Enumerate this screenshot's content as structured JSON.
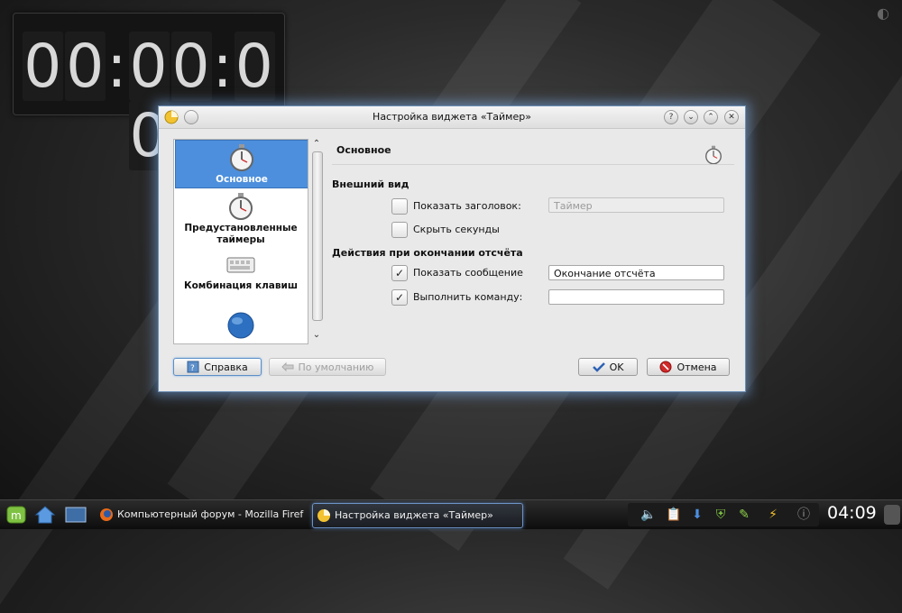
{
  "timer_widget": {
    "display": [
      "0",
      "0",
      ":",
      "0",
      "0",
      ":",
      "0",
      "0"
    ]
  },
  "dialog": {
    "title": "Настройка виджета «Таймер»",
    "sidebar": [
      {
        "label": "Основное",
        "icon": "stopwatch-icon",
        "active": true
      },
      {
        "label": "Предустановленные таймеры",
        "icon": "stopwatch-icon"
      },
      {
        "label": "Комбинация клавиш",
        "icon": "keyboard-icon"
      },
      {
        "label": "",
        "icon": "globe-icon"
      }
    ],
    "panel_title": "Основное",
    "appearance": {
      "heading": "Внешний вид",
      "show_title": {
        "label": "Показать заголовок:",
        "checked": false,
        "value": "Таймер"
      },
      "hide_seconds": {
        "label": "Скрыть секунды",
        "checked": false
      }
    },
    "actions": {
      "heading": "Действия при окончании отсчёта",
      "show_message": {
        "label": "Показать сообщение",
        "checked": true,
        "value": "Окончание отсчёта"
      },
      "run_command": {
        "label": "Выполнить команду:",
        "checked": true,
        "value": ""
      }
    },
    "buttons": {
      "help": "Справка",
      "defaults": "По умолчанию",
      "ok": "OK",
      "cancel": "Отмена"
    }
  },
  "taskbar": {
    "tasks": [
      {
        "label": "Компьютерный форум - Mozilla Firef",
        "icon": "firefox-icon"
      },
      {
        "label": "Настройка виджета «Таймер»",
        "icon": "timer-app-icon",
        "active": true
      }
    ],
    "clock": "04:09"
  },
  "colors": {
    "selection": "#4d8fdc",
    "dialog_glow": "#78aae6"
  }
}
